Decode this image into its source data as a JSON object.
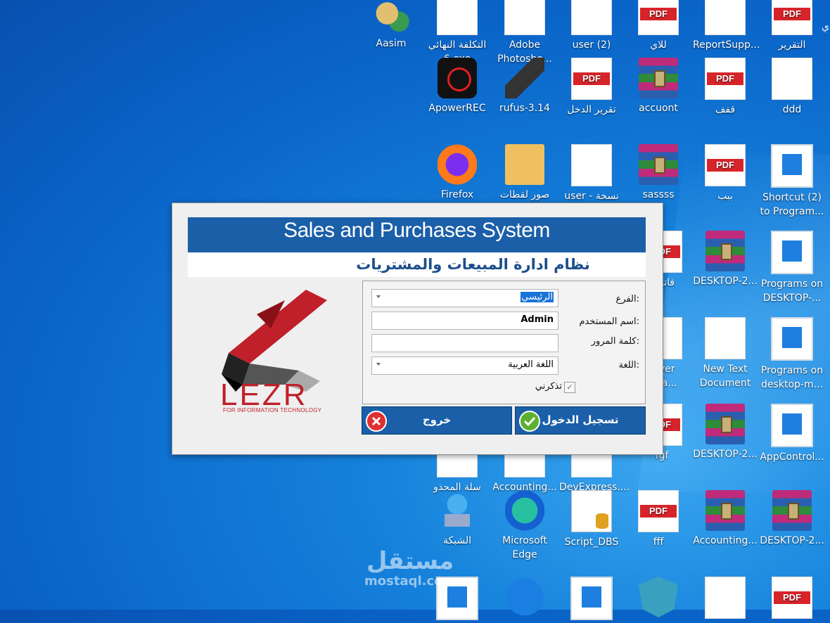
{
  "desktop": {
    "icons": [
      {
        "label": "Aasim",
        "icon": "person-icon"
      },
      {
        "label": "التكلفة النهائي\n6.exe",
        "icon": "exe-icon"
      },
      {
        "label": "Adobe\nPhotosho...",
        "icon": "photoshop-icon"
      },
      {
        "label": "user (2)",
        "icon": "user-doc-icon"
      },
      {
        "label": "للاي",
        "icon": "pdf-icon"
      },
      {
        "label": "ReportSupp...",
        "icon": "doc-icon"
      },
      {
        "label": "التقرير",
        "icon": "pdf-icon"
      },
      {
        "label": "ApowerREC",
        "icon": "recorder-icon"
      },
      {
        "label": "rufus-3.14",
        "icon": "usb-icon"
      },
      {
        "label": "تقرير الدخل",
        "icon": "pdf-icon"
      },
      {
        "label": "accuont",
        "icon": "archive-icon"
      },
      {
        "label": "قفف",
        "icon": "pdf-icon"
      },
      {
        "label": "ddd",
        "icon": "doc-icon"
      },
      {
        "label": "Firefox",
        "icon": "firefox-icon"
      },
      {
        "label": "صور لقطات",
        "icon": "folder-icon"
      },
      {
        "label": "user - نسخة",
        "icon": "user-doc-icon"
      },
      {
        "label": "sassss",
        "icon": "archive-icon"
      },
      {
        "label": "ببب",
        "icon": "pdf-icon"
      },
      {
        "label": "Shortcut (2)\nto Program...",
        "icon": "window-icon"
      },
      {
        "label": "فاتورة",
        "icon": "pdf-icon"
      },
      {
        "label": "DESKTOP-2...",
        "icon": "archive-icon"
      },
      {
        "label": "Programs on\nDESKTOP-...",
        "icon": "window-icon"
      },
      {
        "label": "erver\nlana...",
        "icon": "server-icon"
      },
      {
        "label": "New Text\nDocument",
        "icon": "doc-icon"
      },
      {
        "label": "Programs on\ndesktop-m...",
        "icon": "window-icon"
      },
      {
        "label": "fgf",
        "icon": "pdf-icon"
      },
      {
        "label": "DESKTOP-2...",
        "icon": "archive-icon"
      },
      {
        "label": "AppControl...",
        "icon": "window-icon"
      },
      {
        "label": "سلة المحذو\nفات",
        "icon": "recycle-icon"
      },
      {
        "label": "Accounting...",
        "icon": "app-icon"
      },
      {
        "label": "DevExpress....",
        "icon": "app-icon"
      },
      {
        "label": "الشبكة",
        "icon": "network-icon"
      },
      {
        "label": "Microsoft\nEdge",
        "icon": "edge-icon"
      },
      {
        "label": "Script_DBS",
        "icon": "script-icon"
      },
      {
        "label": "fff",
        "icon": "pdf-icon"
      },
      {
        "label": "Accounting...",
        "icon": "archive-icon"
      },
      {
        "label": "DESKTOP-2...",
        "icon": "archive-icon"
      }
    ]
  },
  "dialog": {
    "title_en": "Sales and Purchases System",
    "title_ar": "نظام ادارة المبيعات والمشتريات",
    "logo_text": "LEZR",
    "logo_sub": "FOR INFORMATION TECHNOLOGY",
    "branch_label": "الفرع:",
    "branch_value": "الرئيسي",
    "username_label": "اسم المستخدم:",
    "username_value": "Admin",
    "password_label": "كلمة المرور:",
    "password_value": "",
    "language_label": "اللغة:",
    "language_value": "اللغة العربية",
    "remember_label": "تذكرني",
    "remember_checked": true,
    "login_button": "تسجيل الدخول",
    "exit_button": "خروج"
  },
  "watermark": {
    "line1": "مستقل",
    "line2": "mostaql.com"
  },
  "colors": {
    "banner": "#1b5fa8",
    "logo_red": "#c0202a",
    "desktop": "#0a64c8"
  }
}
